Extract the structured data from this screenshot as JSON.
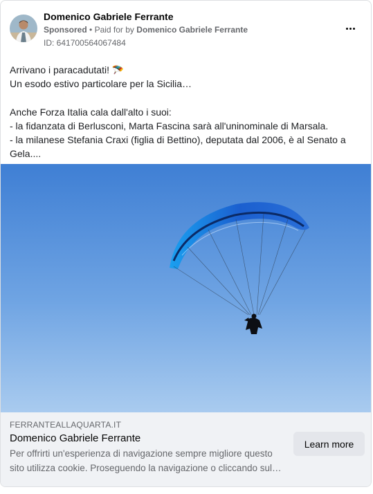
{
  "advertiser": {
    "name": "Domenico Gabriele Ferrante",
    "sponsored_label": "Sponsored",
    "separator": "•",
    "paid_for_prefix": "Paid for by",
    "paid_for_name": "Domenico Gabriele Ferrante",
    "ad_id": "ID: 641700564067484",
    "avatar_icon": "profile-photo"
  },
  "menu": {
    "icon": "more-options-icon"
  },
  "post": {
    "line1": "Arrivano i paracadutati! 🪂",
    "line2": "Un esodo estivo particolare per la Sicilia…",
    "line3": "Anche Forza Italia cala dall'alto i suoi:",
    "line4": "- la fidanzata di Berlusconi, Marta Fascina sarà all'uninominale di Marsala.",
    "line5": "- la milanese Stefania Craxi (figlia di Bettino), deputata dal 2006, è al Senato a Gela...."
  },
  "media": {
    "description_icon": "paraglider-image",
    "sky_top": "#3f7fd4",
    "sky_bottom": "#9cc2ec",
    "wing_color": "#1b5fcf"
  },
  "link": {
    "domain": "FERRANTEALLAQUARTA.IT",
    "title": "Domenico Gabriele Ferrante",
    "description": "Per offrirti un'esperienza di navigazione sempre migliore questo sito utilizza cookie. Proseguendo la navigazione o cliccando sul…",
    "cta_label": "Learn more"
  }
}
